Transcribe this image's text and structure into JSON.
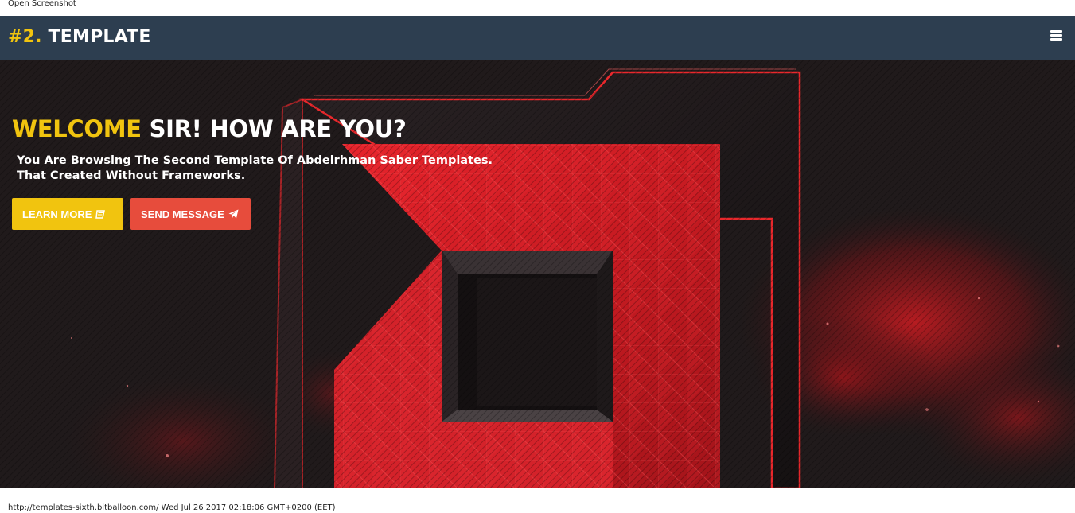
{
  "page": {
    "top_caption": "Open Screenshot",
    "bottom_caption": "http://templates-sixth.bitballoon.com/ Wed Jul 26 2017 02:18:06 GMT+0200 (EET)"
  },
  "navbar": {
    "brand_number": "#2.",
    "brand_text": " TEMPLATE",
    "menu_icon": "hamburger-menu-icon",
    "background_color": "#2d3e50"
  },
  "hero": {
    "title_accent": "WELCOME",
    "title_rest": " SIR! HOW ARE YOU?",
    "subtitle_line1": "You Are Browsing The Second Template Of Abdelrhman Saber Templates.",
    "subtitle_line2": "That Created Without Frameworks.",
    "accent_color": "#f1c40f",
    "buttons": {
      "learn_more": {
        "label": "LEARN MORE",
        "icon": "book-icon",
        "color": "#f1c40f"
      },
      "send_message": {
        "label": "SEND MESSAGE",
        "icon": "paper-plane-icon",
        "color": "#e74c3c"
      }
    }
  }
}
